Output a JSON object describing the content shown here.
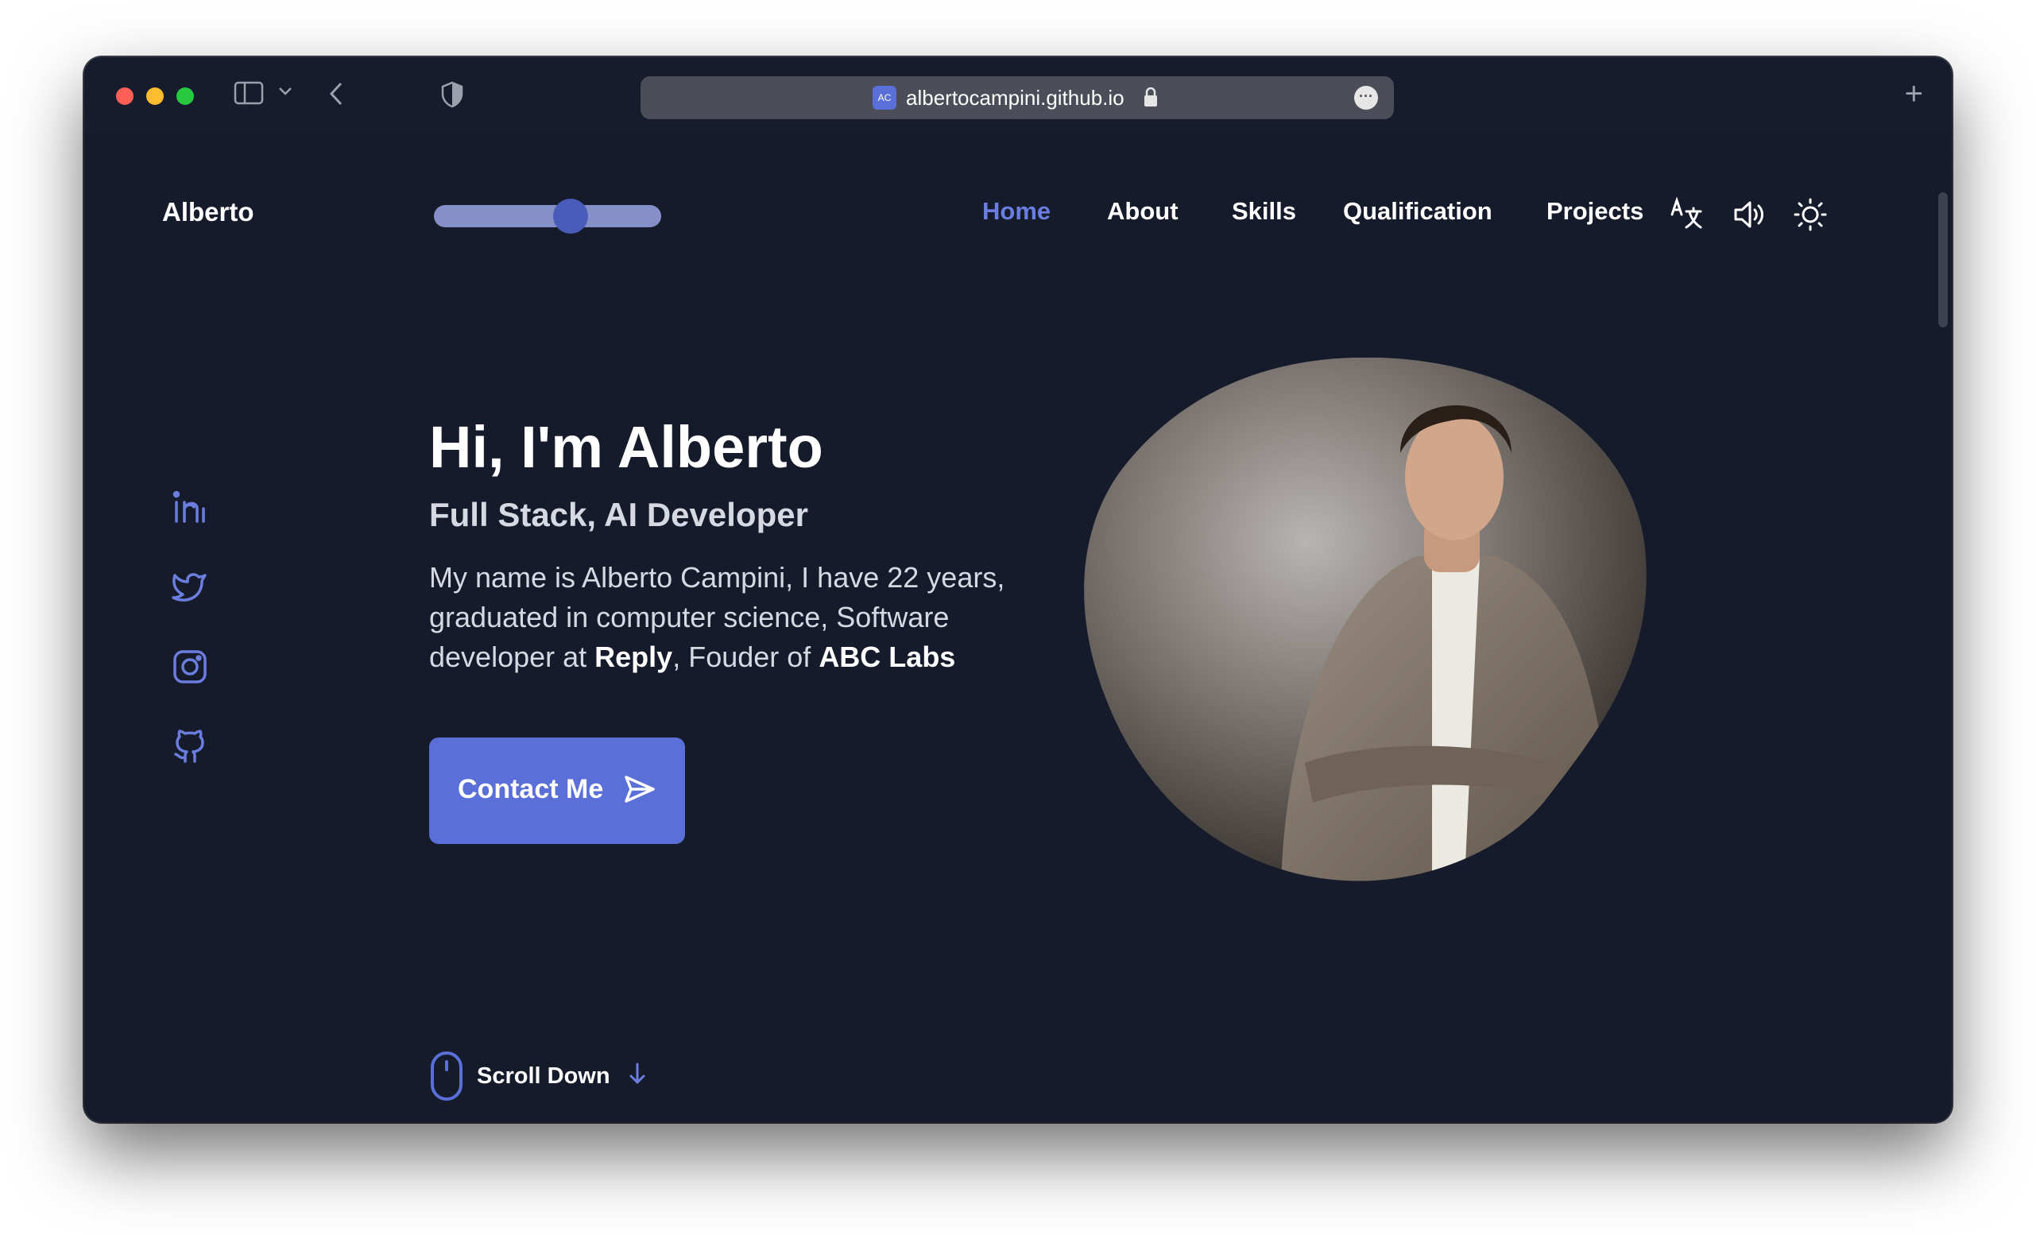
{
  "browser": {
    "url": "albertocampini.github.io",
    "favicon_text": "AC"
  },
  "site": {
    "logo": "Alberto",
    "nav": [
      "Home",
      "About",
      "Skills",
      "Qualification",
      "Projects"
    ],
    "active_nav": "Home",
    "slider_level": 0.62,
    "icons": [
      "translate-icon",
      "speaker-icon",
      "sun-icon"
    ],
    "socials": [
      "linkedin-icon",
      "twitter-icon",
      "instagram-icon",
      "github-icon"
    ]
  },
  "hero": {
    "title": "Hi, I'm Alberto",
    "subtitle": "Full Stack, AI Developer",
    "desc_part1": "My name is Alberto Campini, I have 22 years, graduated in computer science, Software developer at ",
    "desc_bold1": "Reply",
    "desc_part2": ", Fouder of ",
    "desc_bold2": "ABC Labs",
    "cta": "Contact Me",
    "scroll_label": "Scroll Down"
  },
  "colors": {
    "background": "#151b2b",
    "accent": "#5b6fd8",
    "active_link": "#6b7ee0",
    "text": "#ffffff"
  }
}
